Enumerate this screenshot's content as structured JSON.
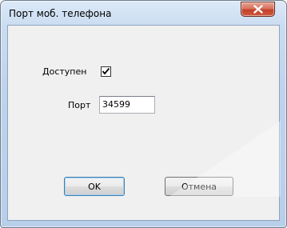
{
  "window": {
    "title": "Порт моб. телефона",
    "close_icon": "close-x-icon"
  },
  "form": {
    "available_label": "Доступен",
    "available_checked": true,
    "port_label": "Порт",
    "port_value": "34599"
  },
  "buttons": {
    "ok_label": "OK",
    "cancel_label": "Отмена"
  },
  "colors": {
    "close_button": "#c2402a",
    "frame": "#bed3ec",
    "client_bg": "#f0f0f0"
  }
}
